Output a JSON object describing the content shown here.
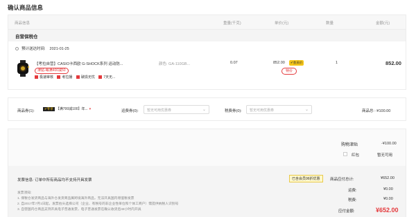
{
  "page": {
    "title": "确认商品信息"
  },
  "table": {
    "headers": [
      "商品信息",
      "重量(千克)",
      "单价(元)",
      "数量",
      "金额(元)"
    ]
  },
  "shop": {
    "name": "自营保税仓"
  },
  "delivery": {
    "label": "预计送达时间:",
    "date": "2021-01-25"
  },
  "product": {
    "title": "【考拉自营】CASIO卡西欧 G-SHOCK系列 运动防...",
    "promo_tag": "津贴-每满400减50",
    "services": [
      "极速审核",
      "考拉播",
      "破损无忧",
      "7天无..."
    ],
    "attribute": "颜色: GA-110GB...",
    "weight": "0.07",
    "price": "852.00",
    "member_badge": "✔会员价",
    "special_label": "特价",
    "quantity": "1",
    "amount": "852.00"
  },
  "coupons": {
    "goods_coupon_label": "商品券(1):",
    "goods_coupon_vip": "✔专享",
    "goods_coupon_value": "【满799减100】年...",
    "freight_label": "运费券(0):",
    "freight_placeholder": "暂无可用优惠券",
    "tax_label": "税费券(0):",
    "tax_placeholder": "暂无可用优惠券",
    "total": "商品总: -¥100.00"
  },
  "summary": {
    "jintie_label": "购物津贴",
    "jintie_value": "-¥100.00",
    "hongbao_label": "红包",
    "hongbao_value": "暂无可用",
    "invoice_info": "发票信息:  订单中所有商品均不支持开具发票",
    "member_tag": "已含会员96折优惠",
    "goods_total_label": "商品应付总计:",
    "goods_total_value": "¥652.00",
    "freight_label": "运费:",
    "freight_value": "¥0.00",
    "tax_label": "税费:",
    "tax_value": "¥0.00",
    "final_label": "应付金额:",
    "final_value": "¥652.00",
    "notes": [
      "发票须知:",
      "1. 保税仓发货商品与海外仓发货商品属跨境海外商品，无法开具国内增值税发票",
      "2. 自2017年7月1日起，发票抬头选择公司（企业、有税号的非企业性单位和个体工商户）需提供纳税人识别号",
      "3. 自营国内仓商品支持开具电子普通发票，电子普通发票在确认收货后48小时内开具"
    ]
  },
  "colors": {
    "accent": "#e4393c",
    "gold": "#f5c518"
  }
}
